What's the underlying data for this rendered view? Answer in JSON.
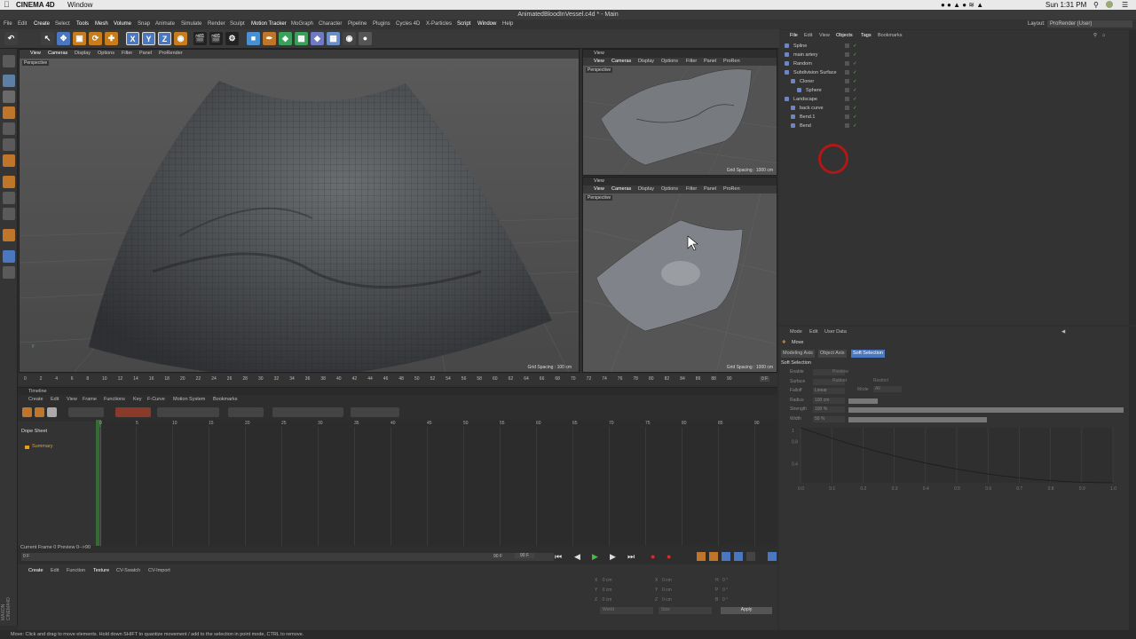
{
  "mac_menubar": {
    "app_name": "CINEMA 4D",
    "menu_window": "Window",
    "clock": "Sun 1:31 PM"
  },
  "window": {
    "title": "AnimatedBloodInVessel.c4d * - Main",
    "layout_label": "Layout:",
    "layout_value": "ProRender (User)"
  },
  "app_menu": [
    "File",
    "Edit",
    "Create",
    "Select",
    "Tools",
    "Mesh",
    "Volume",
    "Snap",
    "Animate",
    "Simulate",
    "Render",
    "Sculpt",
    "Motion Tracker",
    "MoGraph",
    "Character",
    "Pipeline",
    "Plugins",
    "Cycles 4D",
    "X-Particles",
    "Script",
    "Window",
    "Help"
  ],
  "toolbar": {
    "axis_x": "X",
    "axis_y": "Y",
    "axis_z": "Z"
  },
  "viewport_main": {
    "menu": [
      "View",
      "Cameras",
      "Display",
      "Options",
      "Filter",
      "Panel",
      "ProRender"
    ],
    "camera_label": "Perspective",
    "grid_spacing": "Grid Spacing : 100 cm"
  },
  "viewport_top": {
    "header": "View",
    "menu": [
      "View",
      "Cameras",
      "Display",
      "Options",
      "Filter",
      "Panel",
      "ProRen"
    ],
    "camera_label": "Perspective",
    "grid_spacing": "Grid Spacing : 1000 cm"
  },
  "viewport_bottom": {
    "header": "View",
    "menu": [
      "View",
      "Cameras",
      "Display",
      "Options",
      "Filter",
      "Panel",
      "ProRen"
    ],
    "camera_label": "Perspective",
    "grid_spacing": "Grid Spacing : 1000 cm"
  },
  "ruler": {
    "ticks": [
      "0",
      "2",
      "4",
      "6",
      "8",
      "10",
      "12",
      "14",
      "16",
      "18",
      "20",
      "22",
      "24",
      "26",
      "28",
      "30",
      "32",
      "34",
      "36",
      "38",
      "40",
      "42",
      "44",
      "46",
      "48",
      "50",
      "52",
      "54",
      "56",
      "58",
      "60",
      "62",
      "64",
      "66",
      "68",
      "70",
      "72",
      "74",
      "76",
      "78",
      "80",
      "82",
      "84",
      "86",
      "88",
      "90"
    ],
    "frame": "0 F"
  },
  "object_manager": {
    "menu": [
      "File",
      "Edit",
      "View",
      "Objects",
      "Tags",
      "Bookmarks"
    ],
    "objects": [
      {
        "name": "Spline",
        "indent": 0
      },
      {
        "name": "main artery",
        "indent": 0
      },
      {
        "name": "Random",
        "indent": 0
      },
      {
        "name": "Subdivision Surface",
        "indent": 0
      },
      {
        "name": "Cloner",
        "indent": 1
      },
      {
        "name": "Sphere",
        "indent": 2
      },
      {
        "name": "Landscape",
        "indent": 0
      },
      {
        "name": "back curve",
        "indent": 1
      },
      {
        "name": "Bend.1",
        "indent": 1
      },
      {
        "name": "Bend",
        "indent": 1
      }
    ]
  },
  "attributes": {
    "menu": [
      "Mode",
      "Edit",
      "User Data"
    ],
    "tool_name": "Move",
    "tabs": [
      "Modeling Axis",
      "Object Axis",
      "Soft Selection"
    ],
    "section": "Soft Selection",
    "fields": [
      {
        "label": "Enable",
        "value": ""
      },
      {
        "label": "Surface",
        "value": ""
      },
      {
        "label": "Falloff",
        "value": "Linear"
      },
      {
        "label": "Radius",
        "value": "100 cm"
      },
      {
        "label": "Strength",
        "value": "100 %"
      },
      {
        "label": "Width",
        "value": "50 %"
      }
    ],
    "extra_labels": [
      "Preview",
      "Rubber",
      "Restrict",
      "Mode"
    ],
    "mode_value": "All",
    "graph_y": [
      "1",
      "0.8",
      "0.4"
    ],
    "graph_x": [
      "0.0",
      "0.1",
      "0.2",
      "0.3",
      "0.4",
      "0.5",
      "0.6",
      "0.7",
      "0.8",
      "0.9",
      "1.0"
    ]
  },
  "timeline": {
    "title": "Timeline",
    "menu": [
      "Create",
      "Edit",
      "View",
      "Frame",
      "Functions",
      "Key",
      "F-Curve",
      "Motion System",
      "Bookmarks"
    ],
    "dope_sheet": "Dope Sheet",
    "summary": "Summary",
    "frame_ticks": [
      "0",
      "5",
      "10",
      "15",
      "20",
      "25",
      "30",
      "35",
      "40",
      "45",
      "50",
      "55",
      "60",
      "65",
      "70",
      "75",
      "80",
      "85",
      "90"
    ],
    "current_frame": "Current Frame  0  Preview  0-->90",
    "start_frame": "0 F",
    "end_frame": "90 F",
    "end_frame2": "90 F"
  },
  "material": {
    "menu": [
      "Create",
      "Edit",
      "Function",
      "Texture",
      "CV-Swatch",
      "CV-Import"
    ]
  },
  "coordinates": {
    "rows": [
      {
        "a": "X",
        "av": "0 cm",
        "b": "X",
        "bv": "0 cm",
        "c": "H",
        "cv": "0 °"
      },
      {
        "a": "Y",
        "av": "0 cm",
        "b": "Y",
        "bv": "0 cm",
        "c": "P",
        "cv": "0 °"
      },
      {
        "a": "Z",
        "av": "0 cm",
        "b": "Z",
        "bv": "0 cm",
        "c": "B",
        "cv": "0 °"
      }
    ],
    "world": "World",
    "size": "Size",
    "apply": "Apply"
  },
  "status_bar": "Move: Click and drag to move elements. Hold down SHIFT to quantize movement / add to the selection in point mode, CTRL to remove.",
  "colors": {
    "accent": "#ff9d00",
    "selection": "#4a78c0"
  }
}
